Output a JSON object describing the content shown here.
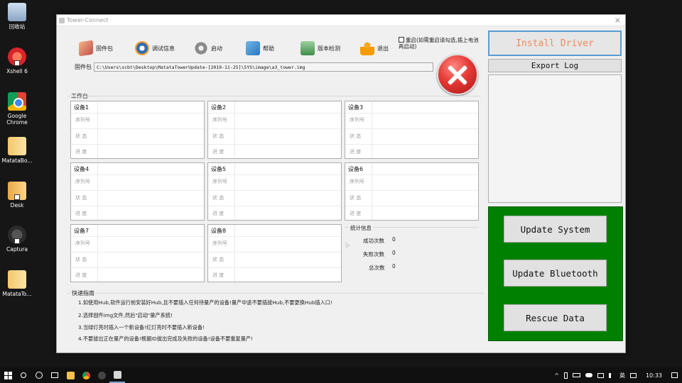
{
  "desktop": {
    "icons": [
      {
        "label": "回收站"
      },
      {
        "label": "Xshell 6"
      },
      {
        "label": "Google Chrome"
      },
      {
        "label": "MatataBo..."
      },
      {
        "label": "Desk"
      },
      {
        "label": "Captura"
      },
      {
        "label": "MatataTo..."
      }
    ]
  },
  "window": {
    "title": "Tower-Connect",
    "close_glyph": "×",
    "toolbar": {
      "firmware": "固件包",
      "debug": "调试信息",
      "start": "启动",
      "help": "帮助",
      "version": "版本检测",
      "exit": "退出"
    },
    "reboot_label": "重启(如需重启请勾选,插上电池再启动)",
    "firmware_label": "固件包",
    "firmware_path": "C:\\Users\\scbt\\Desktop\\MatataTowerUpdate-[2019-11-25]\\SYS\\image\\a3_tower.img",
    "workspace_label": "工作台",
    "device_fields": {
      "serial": "序列号",
      "status": "状 态",
      "progress": "进 度"
    },
    "devices": [
      {
        "name": "设备1"
      },
      {
        "name": "设备2"
      },
      {
        "name": "设备3"
      },
      {
        "name": "设备4"
      },
      {
        "name": "设备5"
      },
      {
        "name": "设备6"
      },
      {
        "name": "设备7"
      },
      {
        "name": "设备8"
      }
    ],
    "stats": {
      "title": "统计信息",
      "success_label": "成功次数",
      "success_value": "0",
      "fail_label": "失败次数",
      "fail_value": "0",
      "total_label": "总次数",
      "total_value": "0"
    },
    "guide": {
      "title": "快速指南",
      "lines": [
        "1.如使用Hub,软件运行前安装好Hub,且不要插入任何待量产的设备!量产中途不要插拔Hub,不要更换Hub插入口!",
        "2.选择固件img文件,然后\"启动\"量产系统!",
        "3.当绿灯亮时插入一个新设备!红灯亮时不要插入新设备!",
        "4.不要拔出正在量产的设备!根据ID拔出完成及失败的设备!设备不要重复量产!"
      ]
    },
    "right_panel": {
      "install_driver": "Install Driver",
      "export_log": "Export Log",
      "update_system": "Update System",
      "update_bluetooth": "Update Bluetooth",
      "rescue_data": "Rescue Data"
    }
  },
  "taskbar": {
    "ime": "英",
    "time": "10:33"
  }
}
